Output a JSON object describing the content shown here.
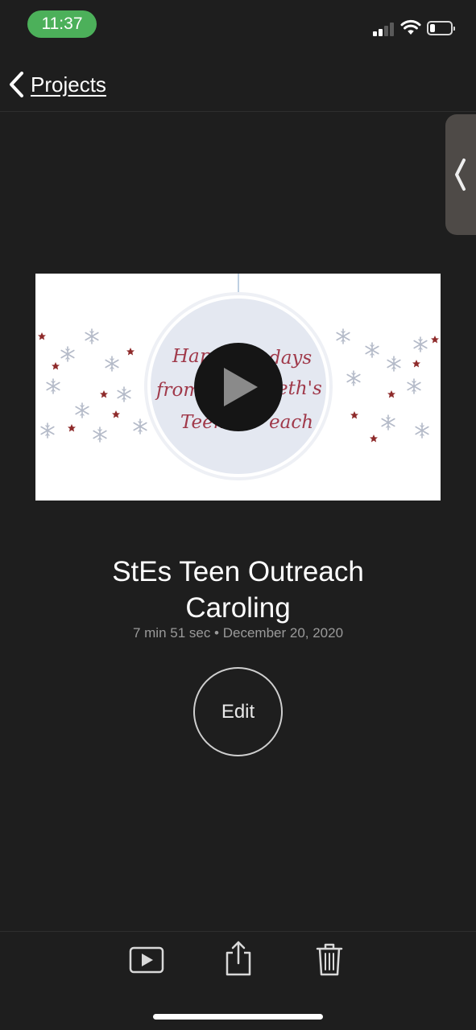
{
  "status_bar": {
    "time": "11:37"
  },
  "nav": {
    "back_label": "Projects"
  },
  "project": {
    "title_line1": "StEs Teen Outreach",
    "title_line2": "Caroling",
    "meta": "7 min 51 sec • December 20, 2020",
    "edit_label": "Edit"
  },
  "thumbnail": {
    "ornament_line1_left": "Hap",
    "ornament_line1_right": "days",
    "ornament_line2_left": "from",
    "ornament_line2_right": "eth's",
    "ornament_line3_left": "Teen",
    "ornament_line3_right": "each"
  },
  "toolbar": {
    "icons": [
      "play-icon",
      "share-icon",
      "trash-icon"
    ]
  },
  "colors": {
    "background": "#1e1e1e",
    "status_time_pill": "#4cb05a",
    "side_tab": "#4e4a47",
    "ornament_text": "#a0394a",
    "meta_text": "#9a9a9a"
  }
}
